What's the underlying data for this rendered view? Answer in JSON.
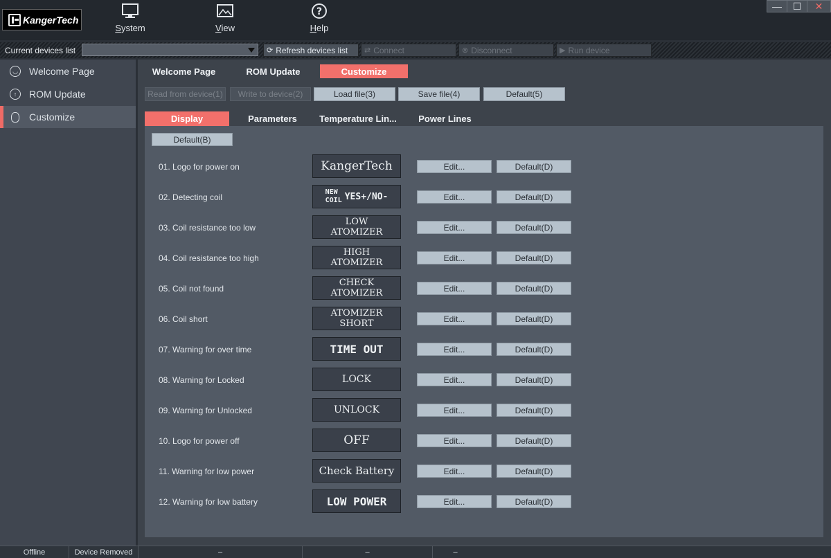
{
  "app": {
    "logo_text": "KangerTech"
  },
  "menu": {
    "system": {
      "first": "S",
      "rest": "ystem"
    },
    "view": {
      "first": "V",
      "rest": "iew"
    },
    "help": {
      "first": "H",
      "rest": "elp"
    }
  },
  "window": {
    "minimize": "—",
    "maximize": "☐",
    "close": "✕"
  },
  "devices": {
    "label": "Current devices list",
    "selected": "",
    "refresh": "Refresh devices list",
    "connect": "Connect",
    "disconnect": "Disconnect",
    "run": "Run device"
  },
  "sidebar": {
    "items": [
      {
        "label": "Welcome Page",
        "icon": "smiley-icon"
      },
      {
        "label": "ROM Update",
        "icon": "upload-icon"
      },
      {
        "label": "Customize",
        "icon": "bulb-icon",
        "selected": true
      }
    ]
  },
  "tabs": [
    "Welcome Page",
    "ROM Update",
    "Customize"
  ],
  "toolbar": {
    "read": "Read from device(1)",
    "write": "Write to device(2)",
    "load": "Load file(3)",
    "save": "Save file(4)",
    "default": "Default(5)"
  },
  "subtabs": [
    "Display",
    "Parameters",
    "Temperature Lin...",
    "Power Lines"
  ],
  "display": {
    "default_button": "Default(B)",
    "edit_label": "Edit...",
    "default_label": "Default(D)",
    "rows": [
      {
        "label": "01. Logo for power on",
        "preview": "KangerTech"
      },
      {
        "label": "02. Detecting coil",
        "preview_top": "NEW",
        "preview_bottom": "COIL",
        "preview": "YES+/NO-"
      },
      {
        "label": "03. Coil resistance too low",
        "preview_line1": "LOW",
        "preview_line2": "ATOMIZER"
      },
      {
        "label": "04. Coil resistance too high",
        "preview_line1": "HIGH",
        "preview_line2": "ATOMIZER"
      },
      {
        "label": "05. Coil not found",
        "preview_line1": "CHECK",
        "preview_line2": "ATOMIZER"
      },
      {
        "label": "06. Coil short",
        "preview_line1": "ATOMIZER",
        "preview_line2": "SHORT"
      },
      {
        "label": "07. Warning for over time",
        "preview": "TIME OUT"
      },
      {
        "label": "08. Warning for Locked",
        "preview": "LOCK"
      },
      {
        "label": "09. Warning for Unlocked",
        "preview": "UNLOCK"
      },
      {
        "label": "10. Logo for power off",
        "preview": "OFF"
      },
      {
        "label": "11. Warning for low power",
        "preview": "Check Battery"
      },
      {
        "label": "12. Warning for low battery",
        "preview": "LOW POWER"
      }
    ]
  },
  "status": {
    "connection": "Offline",
    "device": "Device Removed",
    "f3": "–",
    "f4": "–",
    "f5": "–"
  }
}
